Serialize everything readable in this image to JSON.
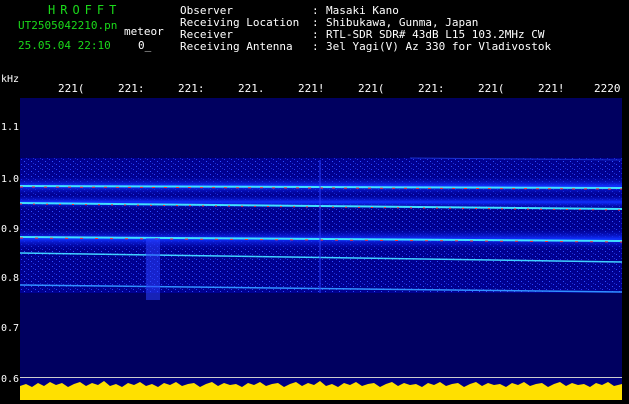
{
  "header": {
    "app_title": "HROFFT",
    "file_name": "UT2505042210.pn",
    "file_type": "meteor",
    "date_time": "25.05.04 22:10",
    "flag": "0_",
    "fields": [
      {
        "label": "Observer",
        "value": "Masaki Kano"
      },
      {
        "label": "Receiving Location",
        "value": "Shibukawa, Gunma, Japan"
      },
      {
        "label": "Receiver",
        "value": "RTL-SDR SDR# 43dB L15 103.2MHz CW"
      },
      {
        "label": "Receiving Antenna",
        "value": "3el Yagi(V) Az 330 for Vladivostok"
      }
    ]
  },
  "axis": {
    "y_unit": "kHz",
    "x_ticks": [
      "221(",
      "221:",
      "221:",
      "221.",
      "221!",
      "221(",
      "221:",
      "221(",
      "221!",
      "2220"
    ],
    "y_ticks": [
      "1.1",
      "1.0",
      "0.9",
      "0.8",
      "0.7",
      "0.6"
    ]
  },
  "colors": {
    "background": "#000000",
    "header_green": "#1ad91a",
    "plot_background": "#000060",
    "signal_low": "#2040ff",
    "signal_mid": "#40e0ff",
    "signal_high": "#ff3030",
    "amplitude": "#ffe000"
  }
}
